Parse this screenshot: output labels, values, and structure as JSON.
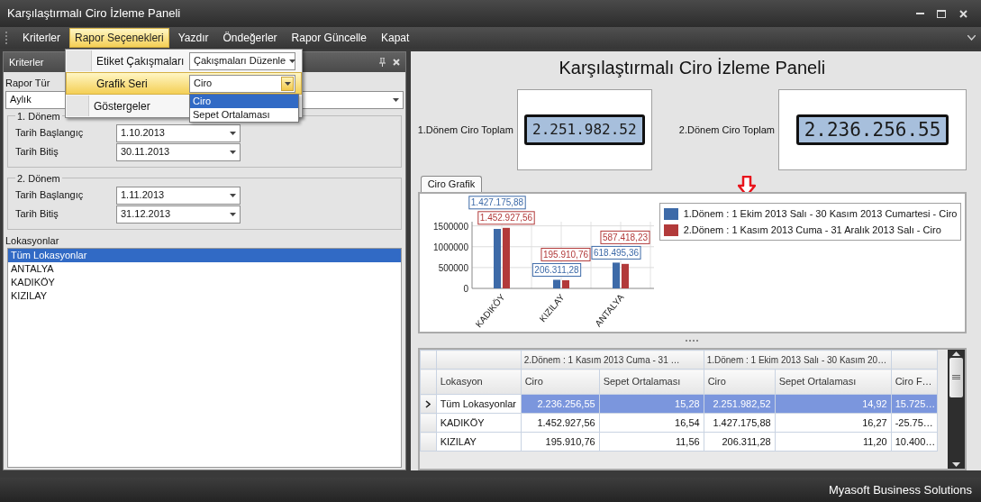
{
  "window": {
    "title": "Karşılaştırmalı Ciro İzleme Paneli"
  },
  "menu": [
    {
      "label": "Kriterler",
      "selected": false
    },
    {
      "label": "Rapor Seçenekleri",
      "selected": true
    },
    {
      "label": "Yazdır",
      "selected": false
    },
    {
      "label": "Öndeğerler",
      "selected": false
    },
    {
      "label": "Rapor Güncelle",
      "selected": false
    },
    {
      "label": "Kapat",
      "selected": false
    }
  ],
  "options_menu": {
    "items": [
      {
        "label": "Etiket Çakışmaları",
        "highlighted": false,
        "value": "Çakışmaları Düzenle"
      },
      {
        "label": "Grafik Seri",
        "highlighted": true,
        "value": "Ciro",
        "expanded": true,
        "options": [
          {
            "label": "Ciro",
            "selected": true
          },
          {
            "label": "Sepet Ortalaması",
            "selected": false
          }
        ]
      },
      {
        "label": "Göstergeler",
        "highlighted": false
      }
    ]
  },
  "criteria_panel": {
    "title": "Kriterler",
    "report_type": {
      "label": "Rapor Tür",
      "value": "Aylık"
    },
    "periods": [
      {
        "title": "1. Dönem",
        "start_label": "Tarih Başlangıç",
        "start": "1.10.2013",
        "end_label": "Tarih Bitiş",
        "end": "30.11.2013"
      },
      {
        "title": "2. Dönem",
        "start_label": "Tarih Başlangıç",
        "start": "1.11.2013",
        "end_label": "Tarih Bitiş",
        "end": "31.12.2013"
      }
    ],
    "locations": {
      "label": "Lokasyonlar",
      "items": [
        {
          "label": "Tüm Lokasyonlar",
          "selected": true
        },
        {
          "label": "ANTALYA",
          "selected": false
        },
        {
          "label": "KADIKÖY",
          "selected": false
        },
        {
          "label": "KIZILAY",
          "selected": false
        }
      ]
    }
  },
  "dashboard": {
    "title": "Karşılaştırmalı Ciro İzleme Paneli",
    "gauges": [
      {
        "label": "1.Dönem Ciro Toplam",
        "reading": "2.251.982.52"
      },
      {
        "label": "2.Dönem Ciro Toplam",
        "reading": "2.236.256.55"
      }
    ],
    "tabs": [
      {
        "label": "Ciro Grafik",
        "selected": true
      }
    ],
    "chart_data": {
      "type": "bar",
      "categories": [
        "KADIKÖY",
        "KIZILAY",
        "ANTALYA"
      ],
      "ylim": [
        0,
        1600000
      ],
      "yticks": [
        0,
        500000,
        1000000,
        1500000
      ],
      "data_labels": true,
      "grid": true,
      "series": [
        {
          "name": "1.Dönem : 1 Ekim 2013 Salı - 30 Kasım 2013 Cumartesi - Ciro",
          "color": "#3d6aa8",
          "values": [
            1427175.88,
            206311.28,
            618495.36
          ],
          "value_labels": [
            "1.427.175,88",
            "206.311,28",
            "618.495,36"
          ]
        },
        {
          "name": "2.Dönem : 1 Kasım 2013 Cuma - 31 Aralık 2013 Salı - Ciro",
          "color": "#b23a3a",
          "values": [
            1452927.56,
            195910.76,
            587418.23
          ],
          "value_labels": [
            "1.452.927,56",
            "195.910,76",
            "587.418,23"
          ]
        }
      ]
    },
    "grid": {
      "column_groups": [
        {
          "columns": [
            "Lokasyon"
          ]
        },
        {
          "title": "2.Dönem : 1 Kasım 2013 Cuma - 31 …",
          "columns": [
            "Ciro",
            "Sepet Ortalaması"
          ]
        },
        {
          "title": "1.Dönem : 1 Ekim 2013 Salı - 30 Kasım 20…",
          "columns": [
            "Ciro",
            "Sepet Ortalaması"
          ]
        },
        {
          "columns": [
            "Ciro F…"
          ]
        }
      ],
      "rows": [
        {
          "selected": true,
          "cells": [
            "Tüm Lokasyonlar",
            "2.236.256,55",
            "15,28",
            "2.251.982,52",
            "14,92",
            "15.725…"
          ]
        },
        {
          "selected": false,
          "cells": [
            "KADIKÖY",
            "1.452.927,56",
            "16,54",
            "1.427.175,88",
            "16,27",
            "-25.75…"
          ]
        },
        {
          "selected": false,
          "cells": [
            "KIZILAY",
            "195.910,76",
            "11,56",
            "206.311,28",
            "11,20",
            "10.400…"
          ]
        }
      ]
    }
  },
  "status_bar": {
    "text": "Myasoft Business Solutions"
  }
}
